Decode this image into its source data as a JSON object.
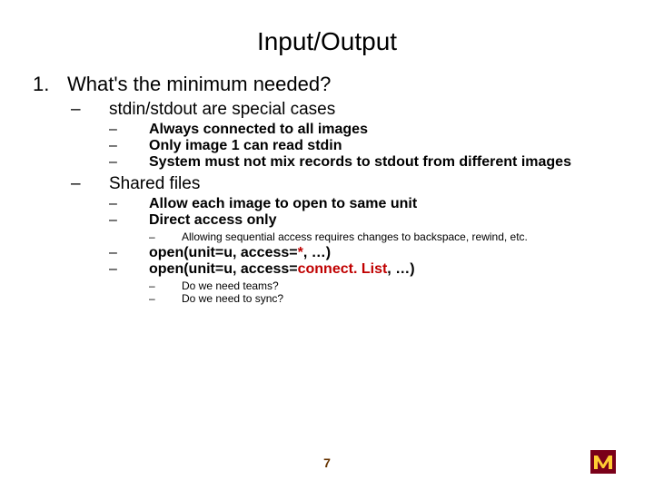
{
  "title": "Input/Output",
  "l1_num": "1.",
  "l1": "What's the minimum needed?",
  "dash": "–",
  "l2a": "stdin/stdout are special cases",
  "l3a1": "Always connected to all images",
  "l3a2": "Only image 1 can read stdin",
  "l3a3": "System must not mix records to stdout from different images",
  "l2b": "Shared files",
  "l3b1": "Allow each image to open to same unit",
  "l3b2": "Direct access only",
  "l4b2a": "Allowing sequential access requires changes to backspace, rewind, etc.",
  "l3b3_pre": "open(unit=u, access=",
  "l3b3_kw": "*",
  "l3b3_post": ", …)",
  "l3b4_pre": "open(unit=u, access=",
  "l3b4_kw": "connect. List",
  "l3b4_post": ", …)",
  "l4b4a": "Do we need teams?",
  "l4b4b": "Do we need to sync?",
  "page": "7"
}
